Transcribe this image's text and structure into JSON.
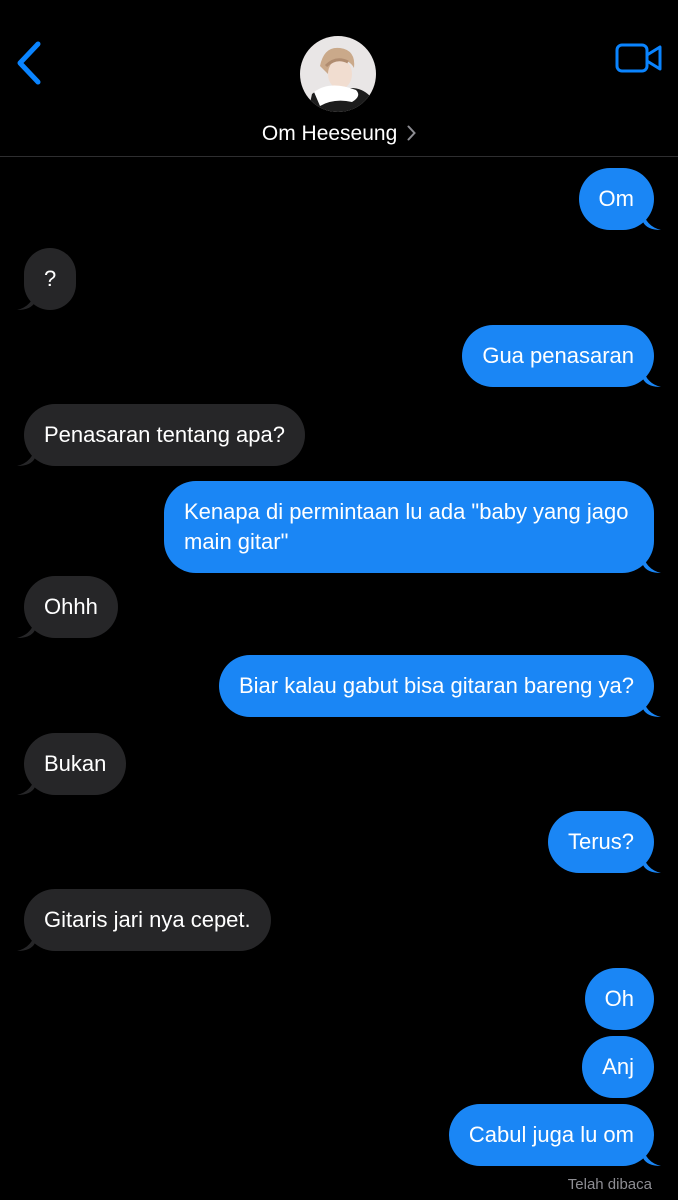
{
  "header": {
    "contact_name": "Om Heeseung",
    "icons": {
      "back": "chevron-left-icon",
      "video": "video-camera-icon",
      "name_chevron": "chevron-right-icon"
    }
  },
  "colors": {
    "outgoing": "#1a86f5",
    "incoming": "#262628",
    "accent": "#0a84ff",
    "background": "#000000"
  },
  "messages": [
    {
      "direction": "out",
      "text": "Om"
    },
    {
      "direction": "in",
      "text": "?"
    },
    {
      "direction": "out",
      "text": "Gua penasaran"
    },
    {
      "direction": "in",
      "text": "Penasaran tentang apa?"
    },
    {
      "direction": "out",
      "text": "Kenapa di permintaan lu ada \"baby yang jago main gitar\""
    },
    {
      "direction": "in",
      "text": "Ohhh"
    },
    {
      "direction": "out",
      "text": "Biar kalau gabut bisa gitaran bareng ya?"
    },
    {
      "direction": "in",
      "text": "Bukan"
    },
    {
      "direction": "out",
      "text": "Terus?"
    },
    {
      "direction": "in",
      "text": "Gitaris jari nya cepet."
    },
    {
      "direction": "out",
      "text": "Oh"
    },
    {
      "direction": "out",
      "text": "Anj"
    },
    {
      "direction": "out",
      "text": "Cabul juga lu om"
    }
  ],
  "status": {
    "read_receipt": "Telah dibaca"
  }
}
